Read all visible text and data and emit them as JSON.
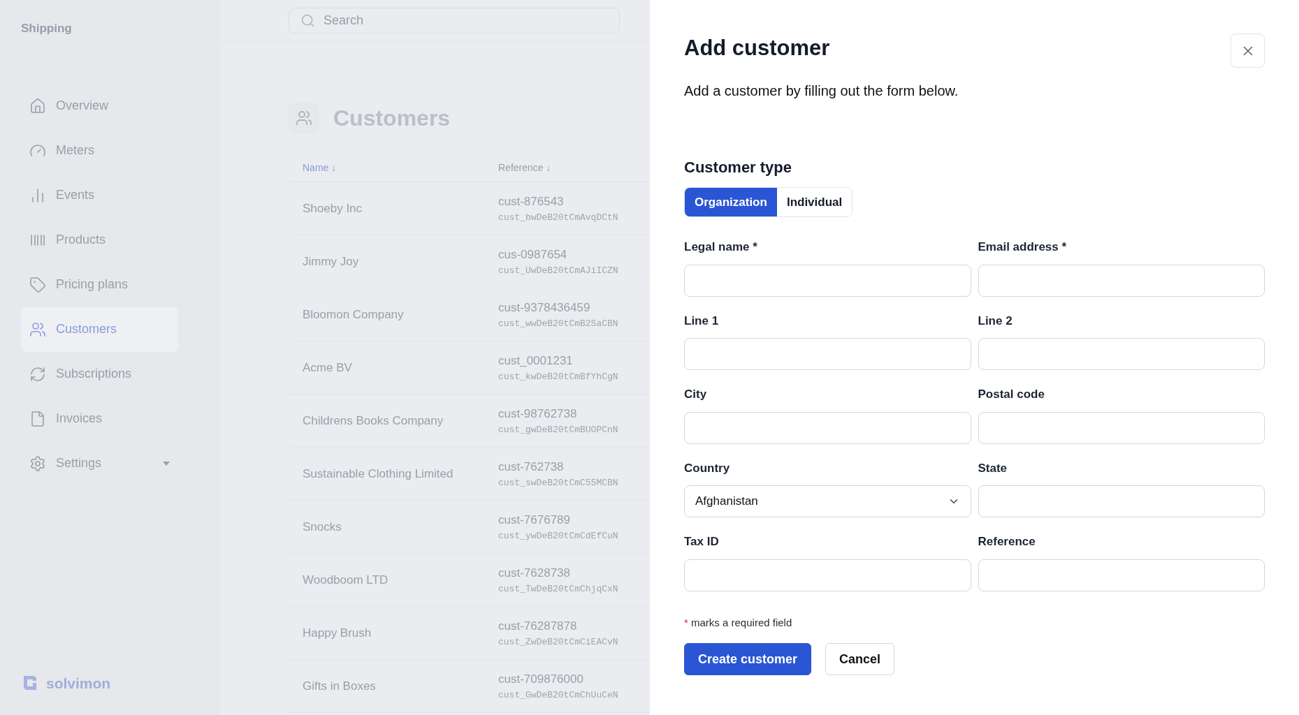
{
  "sidebar": {
    "title": "Shipping",
    "items": [
      {
        "label": "Overview",
        "selected": false
      },
      {
        "label": "Meters",
        "selected": false
      },
      {
        "label": "Events",
        "selected": false
      },
      {
        "label": "Products",
        "selected": false
      },
      {
        "label": "Pricing plans",
        "selected": false
      },
      {
        "label": "Customers",
        "selected": true
      },
      {
        "label": "Subscriptions",
        "selected": false
      },
      {
        "label": "Invoices",
        "selected": false
      },
      {
        "label": "Settings",
        "selected": false,
        "expanded": false
      }
    ],
    "logo": "solvimon"
  },
  "search": {
    "placeholder": "Search"
  },
  "page": {
    "title": "Customers"
  },
  "table": {
    "columns": [
      {
        "label": "Name ↓",
        "selected": true
      },
      {
        "label": "Reference ↓",
        "selected": false
      }
    ],
    "rows": [
      {
        "name": "Shoeby Inc",
        "reference": "cust-876543",
        "id": "cust_bwDeB20tCmAvqDCtN"
      },
      {
        "name": "Jimmy Joy",
        "reference": "cus-0987654",
        "id": "cust_UwDeB20tCmAJiICZN"
      },
      {
        "name": "Bloomon Company",
        "reference": "cust-9378436459",
        "id": "cust_wwDeB20tCmB2SaCBN"
      },
      {
        "name": "Acme BV",
        "reference": "cust_0001231",
        "id": "cust_kwDeB20tCmBfYhCgN"
      },
      {
        "name": "Childrens Books Company",
        "reference": "cust-98762738",
        "id": "cust_gwDeB20tCmBUOPCnN"
      },
      {
        "name": "Sustainable Clothing Limited",
        "reference": "cust-762738",
        "id": "cust_swDeB20tCmC55MCBN"
      },
      {
        "name": "Snocks",
        "reference": "cust-7676789",
        "id": "cust_ywDeB20tCmCdEfCuN"
      },
      {
        "name": "Woodboom LTD",
        "reference": "cust-7628738",
        "id": "cust_TwDeB20tCmChjqCxN"
      },
      {
        "name": "Happy Brush",
        "reference": "cust-76287878",
        "id": "cust_ZwDeB20tCmCiEACvN"
      },
      {
        "name": "Gifts in Boxes",
        "reference": "cust-709876000",
        "id": "cust_GwDeB20tCmChUuCeN"
      }
    ]
  },
  "dialog": {
    "title": "Add customer",
    "description": "Add a customer by filling out the form below.",
    "section": "Customer type",
    "types": [
      {
        "label": "Organization",
        "selected": true
      },
      {
        "label": "Individual",
        "selected": false
      }
    ],
    "fields": [
      {
        "label": "Legal name *",
        "kind": "text"
      },
      {
        "label": "Email address *",
        "kind": "text"
      },
      {
        "label": "Line 1",
        "kind": "text"
      },
      {
        "label": "Line 2",
        "kind": "text"
      },
      {
        "label": "City",
        "kind": "text"
      },
      {
        "label": "Postal code",
        "kind": "text"
      },
      {
        "label": "Country",
        "kind": "select",
        "value": "Afghanistan"
      },
      {
        "label": "State",
        "kind": "text"
      },
      {
        "label": "Tax ID",
        "kind": "text"
      },
      {
        "label": "Reference",
        "kind": "text"
      }
    ],
    "required_note": {
      "mark": "*",
      "text": "marks a required field"
    },
    "buttons": [
      {
        "label": "Create customer",
        "kind": "primary"
      },
      {
        "label": "Cancel",
        "kind": "secondary"
      }
    ]
  }
}
